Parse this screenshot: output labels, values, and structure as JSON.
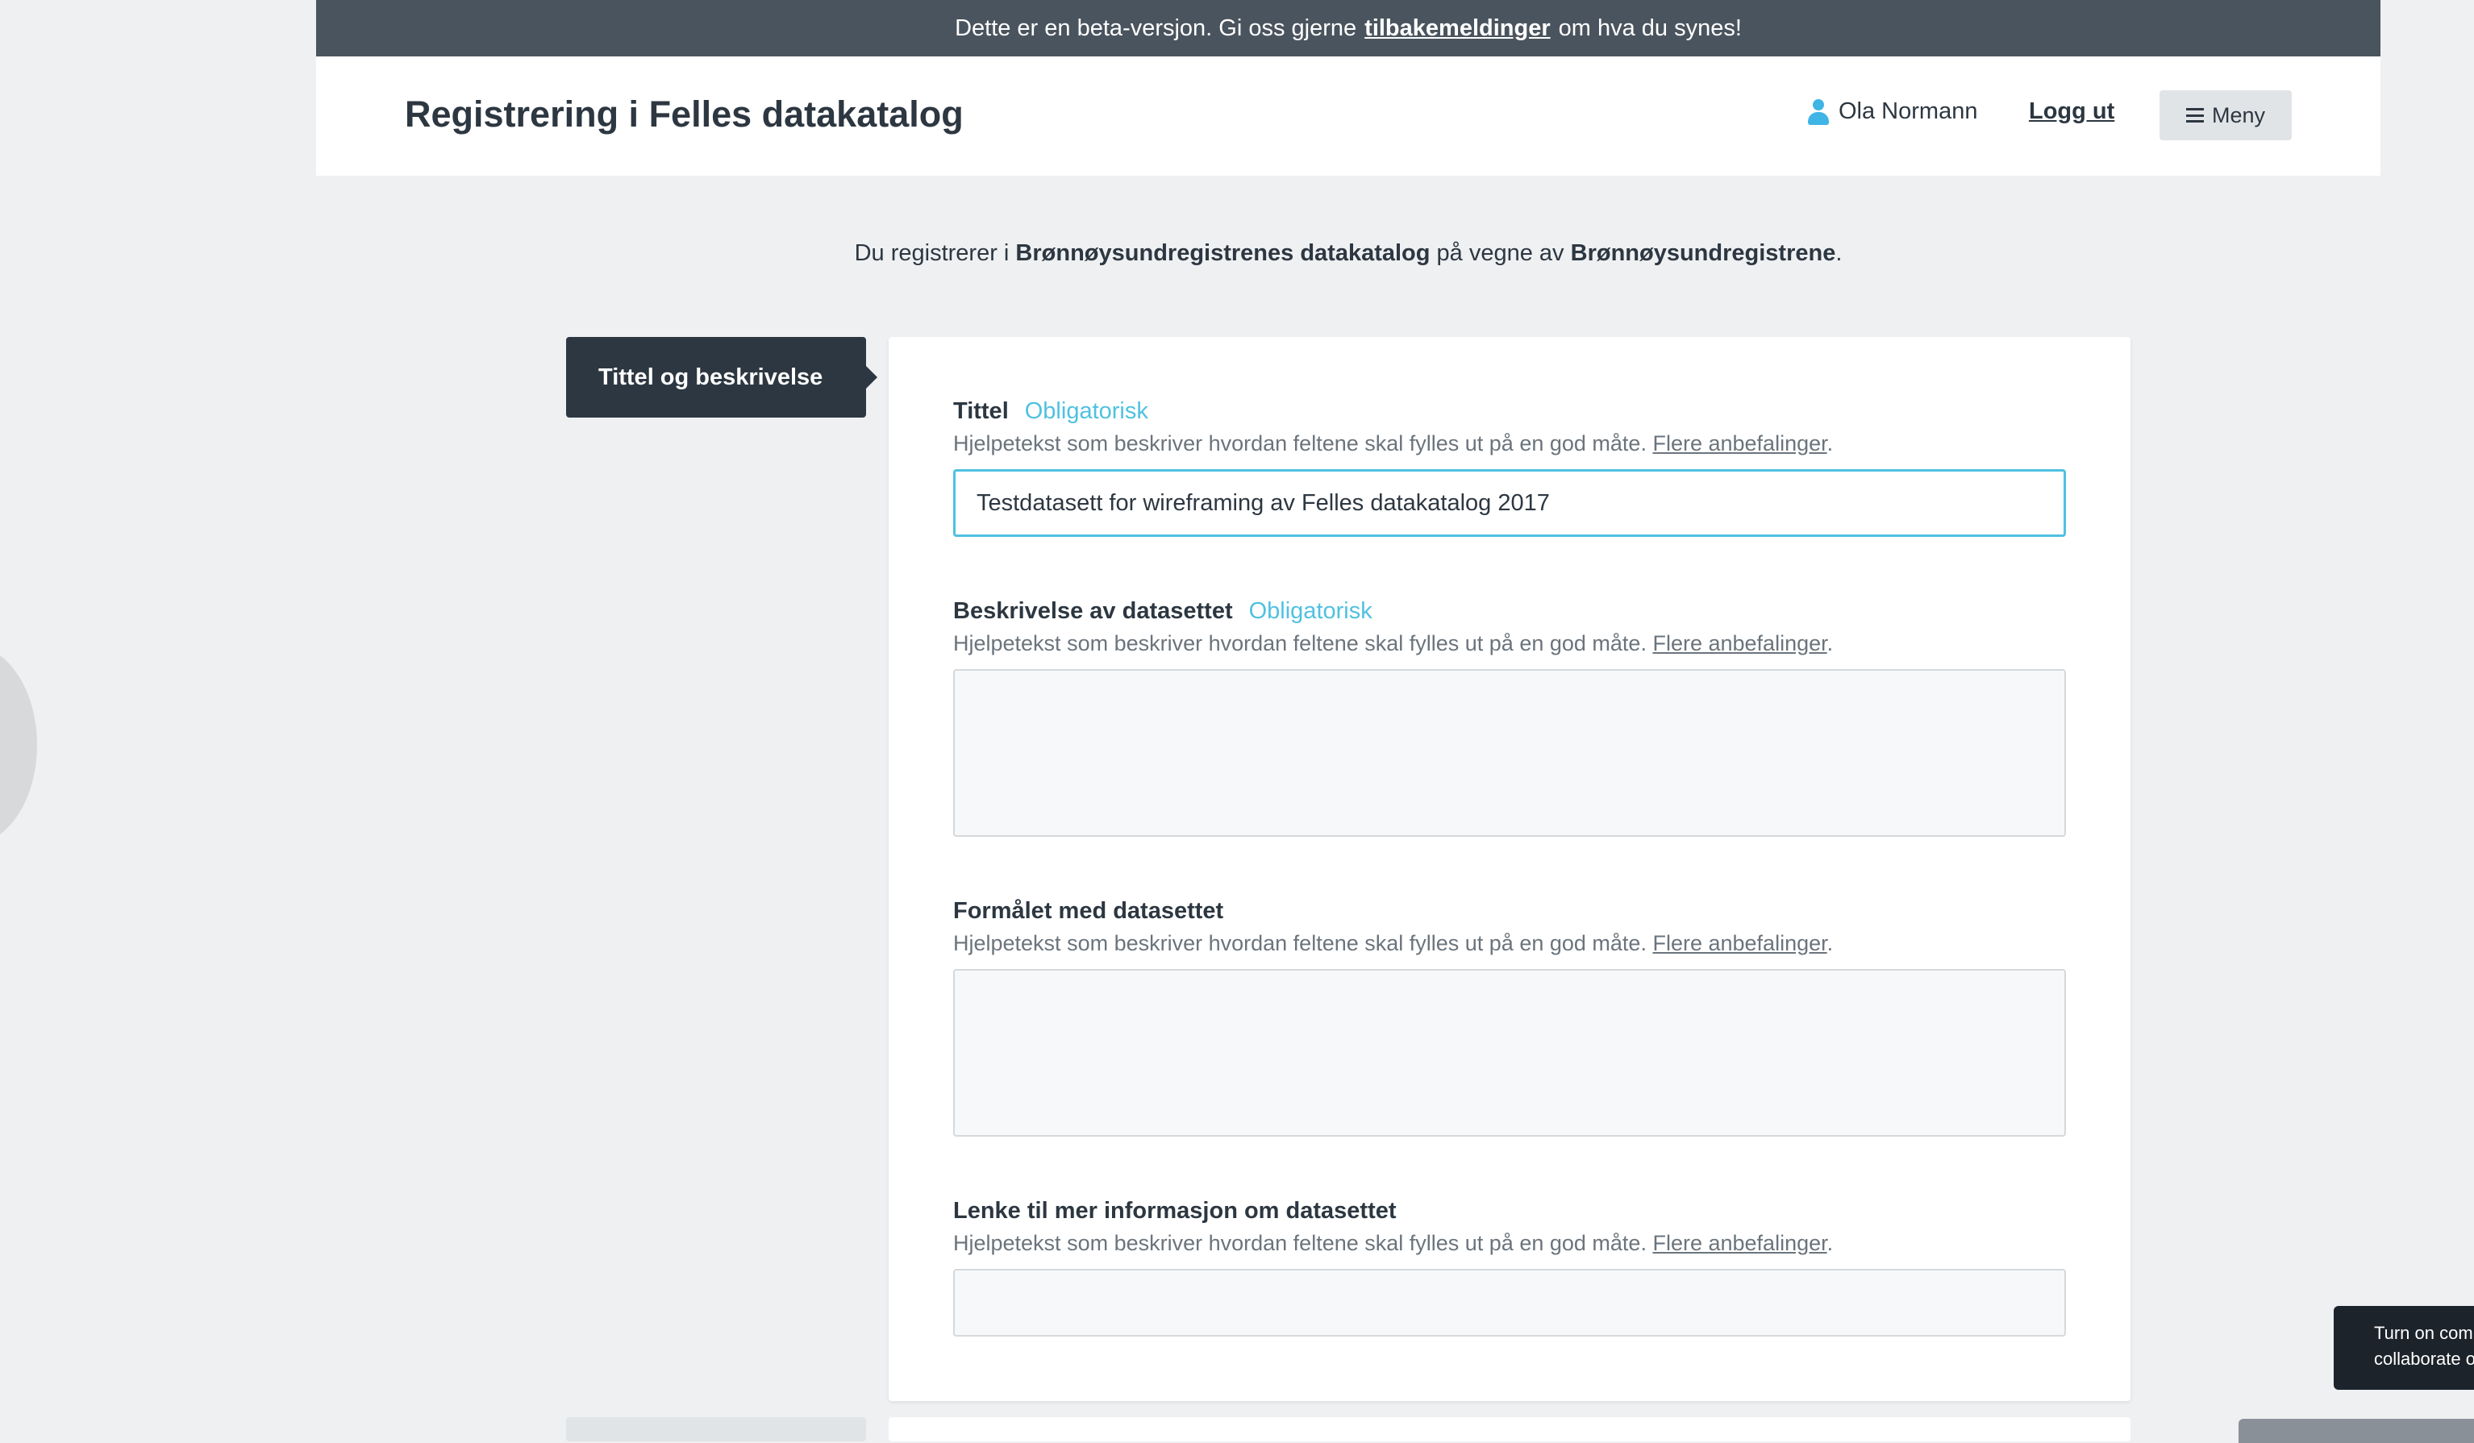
{
  "beta_banner": {
    "prefix": "Dette er en beta-versjon. Gi oss gjerne",
    "link": "tilbakemeldinger",
    "suffix": "om hva du synes!"
  },
  "header": {
    "title": "Registrering i Felles datakatalog",
    "user_name": "Ola Normann",
    "logout": "Logg ut",
    "menu": "Meny"
  },
  "info": {
    "prefix": "Du registrerer i",
    "catalog": "Brønnøysundregistrenes datakatalog",
    "middle": "på vegne av",
    "org": "Brønnøysundregistrene",
    "suffix": "."
  },
  "step_tab": {
    "label": "Tittel og beskrivelse"
  },
  "help_text": "Hjelpetekst som beskriver hvordan feltene skal fylles ut på en god måte.",
  "help_link": "Flere anbefalinger",
  "required_label": "Obligatorisk",
  "fields": [
    {
      "label": "Tittel",
      "required": true,
      "value": "Testdatasett for wireframing av Felles datakatalog 2017",
      "type": "text"
    },
    {
      "label": "Beskrivelse av datasettet",
      "required": true,
      "value": "",
      "type": "textarea"
    },
    {
      "label": "Formålet med datasettet",
      "required": false,
      "value": "",
      "type": "textarea"
    },
    {
      "label": "Lenke til mer informasjon om datasettet",
      "required": false,
      "value": "",
      "type": "text"
    }
  ],
  "toast": {
    "line1": "Turn on com",
    "line2": "collaborate o"
  },
  "colors": {
    "accent": "#4fc1e0",
    "dark": "#2d3741",
    "banner": "#4a545e",
    "background": "#eef0f2"
  }
}
